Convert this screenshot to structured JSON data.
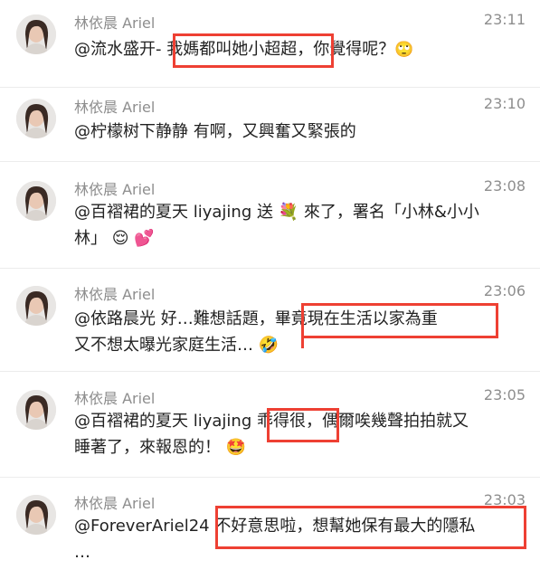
{
  "comments": [
    {
      "author": "林依晨 Ariel",
      "time": "23:11",
      "line1": "@流水盛开- 我媽都叫她小超超，你覺得呢？",
      "emoji1": "🙄",
      "line2": ""
    },
    {
      "author": "林依晨 Ariel",
      "time": "23:10",
      "line1": "@柠檬树下静静 有啊，又興奮又緊張的",
      "emoji1": "",
      "line2": ""
    },
    {
      "author": "林依晨 Ariel",
      "time": "23:08",
      "line1": "@百褶裙的夏天 liyajing 送 💐 來了，署名「小林&小小",
      "emoji1": "",
      "line2": "林」 😌 💕"
    },
    {
      "author": "林依晨 Ariel",
      "time": "23:06",
      "line1": "@依路晨光 好…難想話題，畢竟現在生活以家為重",
      "emoji1": "",
      "line2": "又不想太曝光家庭生活… 🤣"
    },
    {
      "author": "林依晨 Ariel",
      "time": "23:05",
      "line1": "@百褶裙的夏天 liyajing 乖得很，偶爾唉幾聲拍拍就又",
      "emoji1": "",
      "line2": "睡著了，來報恩的！ 🤩"
    },
    {
      "author": "林依晨 Ariel",
      "time": "23:03",
      "line1": "@ForeverAriel24 不好意思啦，想幫她保有最大的隱私",
      "emoji1": "",
      "line2": "…"
    }
  ],
  "colors": {
    "highlight": "#ee4033",
    "meta": "#8e8e8e",
    "text": "#222222"
  }
}
